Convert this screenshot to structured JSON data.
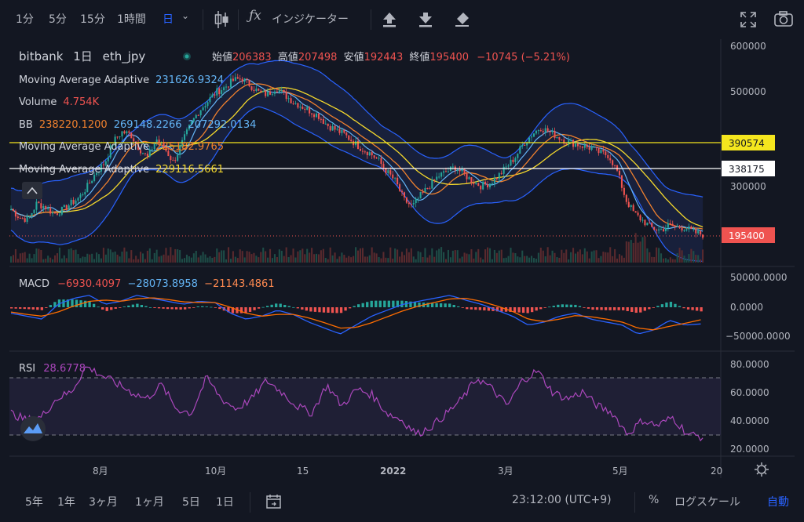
{
  "toolbar": {
    "intervals": [
      "1分",
      "5分",
      "15分",
      "1時間",
      "日"
    ],
    "active_interval": "日",
    "indicators_label": "インジケーター"
  },
  "legend": {
    "symbol": "bitbank",
    "interval": "1日",
    "pair": "eth_jpy",
    "open_label": "始値",
    "open": "206383",
    "high_label": "高値",
    "high": "207498",
    "low_label": "安値",
    "low": "192443",
    "close_label": "終値",
    "close": "195400",
    "change": "−10745 (−5.21%)",
    "ma1_label": "Moving Average Adaptive",
    "ma1_value": "231626.9324",
    "volume_label": "Volume",
    "volume_value": "4.754K",
    "bb_label": "BB",
    "bb_basis": "238220.1200",
    "bb_upper": "269148.2266",
    "bb_lower": "207292.0134",
    "ma2_label": "Moving Average Adaptive",
    "ma2_value": "225182.9765",
    "ma3_label": "Moving Average Adaptive",
    "ma3_value": "229116.5661"
  },
  "price_axis": [
    "600000",
    "500000",
    "400000",
    "300000"
  ],
  "price_tags": {
    "yellow": "390574",
    "white": "338175",
    "last": "195400"
  },
  "macd": {
    "label": "MACD",
    "hist": "−6930.4097",
    "macd": "−28073.8958",
    "signal": "−21143.4861",
    "axis": [
      "50000.0000",
      "0.0000",
      "−50000.0000"
    ]
  },
  "rsi": {
    "label": "RSI",
    "value": "28.6778",
    "axis": [
      "80.0000",
      "60.0000",
      "40.0000",
      "20.0000"
    ]
  },
  "time_axis": [
    "8月",
    "10月",
    "15",
    "2022",
    "3月",
    "5月",
    "20"
  ],
  "bottom": {
    "ranges": [
      "5年",
      "1年",
      "3ヶ月",
      "1ヶ月",
      "5日",
      "1日"
    ],
    "clock": "23:12:00 (UTC+9)",
    "percent": "%",
    "log_scale": "ログスケール",
    "auto": "自動"
  },
  "colors": {
    "bg": "#131722",
    "up": "#26a69a",
    "down": "#ef5350",
    "bb": "#2962ff",
    "macd": "#2962ff",
    "signal": "#ff6d00",
    "rsi": "#ab47bc",
    "ma_yellow": "#f5d92c",
    "ma_orange": "#f0812e",
    "accent": "#2962ff"
  },
  "chart_data": {
    "type": "candlestick",
    "ohlc_close_path": [
      250000,
      232000,
      228000,
      262000,
      255000,
      240000,
      248000,
      262000,
      275000,
      300000,
      330000,
      350000,
      395000,
      415000,
      410000,
      380000,
      360000,
      400000,
      380000,
      350000,
      390000,
      430000,
      460000,
      480000,
      500000,
      510000,
      525000,
      530000,
      515000,
      500000,
      495000,
      510000,
      495000,
      480000,
      470000,
      460000,
      450000,
      430000,
      420000,
      410000,
      395000,
      380000,
      370000,
      355000,
      330000,
      310000,
      270000,
      255000,
      280000,
      300000,
      320000,
      330000,
      340000,
      325000,
      310000,
      300000,
      305000,
      320000,
      340000,
      360000,
      390000,
      410000,
      425000,
      415000,
      405000,
      395000,
      390000,
      385000,
      380000,
      370000,
      365000,
      330000,
      270000,
      240000,
      225000,
      210000,
      205000,
      215000,
      212000,
      210000,
      200000,
      195400
    ],
    "macd_path": [
      -10000,
      -15000,
      -20000,
      5000,
      15000,
      20000,
      5000,
      10000,
      20000,
      15000,
      10000,
      5000,
      10000,
      8000,
      -10000,
      -20000,
      -15000,
      -5000,
      -12000,
      -25000,
      -35000,
      -45000,
      -30000,
      -15000,
      -5000,
      5000,
      10000,
      15000,
      20000,
      12000,
      5000,
      -5000,
      -15000,
      -30000,
      -25000,
      -15000,
      -10000,
      -20000,
      -25000,
      -30000,
      -45000,
      -38000,
      -22000,
      -30000,
      -28000
    ],
    "signal_path": [
      -8000,
      -12000,
      -15000,
      -8000,
      2000,
      10000,
      12000,
      10000,
      14000,
      16000,
      13000,
      9000,
      8000,
      8000,
      0,
      -10000,
      -15000,
      -12000,
      -12000,
      -18000,
      -26000,
      -35000,
      -34000,
      -26000,
      -16000,
      -6000,
      2000,
      8000,
      14000,
      15000,
      10000,
      2000,
      -7000,
      -20000,
      -24000,
      -20000,
      -14000,
      -16000,
      -20000,
      -25000,
      -35000,
      -38000,
      -32000,
      -27000,
      -21000
    ],
    "rsi_path": [
      45,
      40,
      42,
      55,
      60,
      78,
      72,
      66,
      60,
      55,
      65,
      48,
      45,
      70,
      55,
      48,
      55,
      68,
      60,
      50,
      45,
      65,
      50,
      62,
      58,
      45,
      40,
      30,
      36,
      45,
      55,
      70,
      62,
      50,
      68,
      75,
      60,
      55,
      60,
      50,
      45,
      30,
      40,
      36,
      42,
      30,
      28
    ]
  }
}
